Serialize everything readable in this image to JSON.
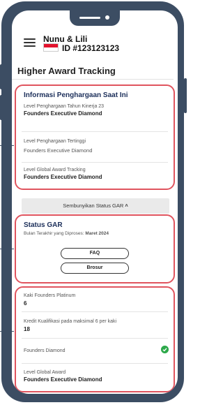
{
  "user": {
    "name": "Nunu & Lili",
    "id": "ID #123123123"
  },
  "page": {
    "title": "Higher Award Tracking"
  },
  "award_info": {
    "title": "Informasi Penghargaan Saat Ini",
    "items": [
      {
        "label": "Level Penghargaan Tahun Kinerja 23",
        "value": "Founders Executive Diamond"
      },
      {
        "label": "Level Penghargaan Tertinggi",
        "value": "Founders Executive Diamond"
      },
      {
        "label": "Level Global Award Tracking",
        "value": "Founders Executive Diamond"
      }
    ]
  },
  "toggle": {
    "label": "Sembunyikan Status GAR"
  },
  "status": {
    "title": "Status GAR",
    "processed_label": "Bulan Terakhir yang Diproses:",
    "processed_value": "Maret 2024",
    "faq_label": "FAQ",
    "brochure_label": "Brosur"
  },
  "details": [
    {
      "label": "Kaki Founders Platinum",
      "value": "6"
    },
    {
      "label": "Kredit Kualifikasi pada maksimal 6 per kaki",
      "value": "18"
    },
    {
      "label": "Founders Diamond",
      "value": ""
    },
    {
      "label": "Level Global Award",
      "value": "Founders Executive Diamond"
    }
  ],
  "colors": {
    "frame": "#3c4d63",
    "highlight": "#e0545e",
    "heading": "#1c2f5a",
    "check": "#2ea94b"
  }
}
